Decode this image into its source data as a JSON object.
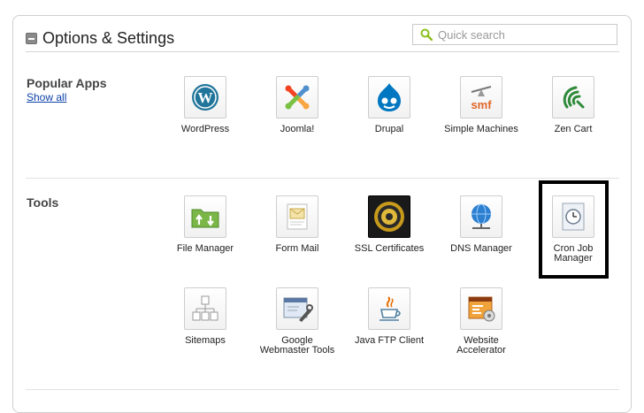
{
  "header": {
    "title": "Options & Settings"
  },
  "search": {
    "placeholder": "Quick search"
  },
  "popular": {
    "label": "Popular Apps",
    "show_all": "Show all",
    "apps": [
      "WordPress",
      "Joomla!",
      "Drupal",
      "Simple Machines",
      "Zen Cart"
    ]
  },
  "tools": {
    "label": "Tools",
    "row1": [
      "File Manager",
      "Form Mail",
      "SSL Certificates",
      "DNS Manager"
    ],
    "cron_line1": "Cron Job",
    "cron_line2": "Manager",
    "row2": [
      "Sitemaps",
      "Java FTP Client"
    ],
    "google_line1": "Google",
    "google_line2": "Webmaster Tools",
    "accel_line1": "Website",
    "accel_line2": "Accelerator"
  },
  "icons": {
    "search": "magnifier-icon",
    "smf_text": "smf"
  },
  "colors": {
    "link": "#0a3fa8",
    "highlight_border": "#000000",
    "search_icon": "#8bbf1e"
  }
}
